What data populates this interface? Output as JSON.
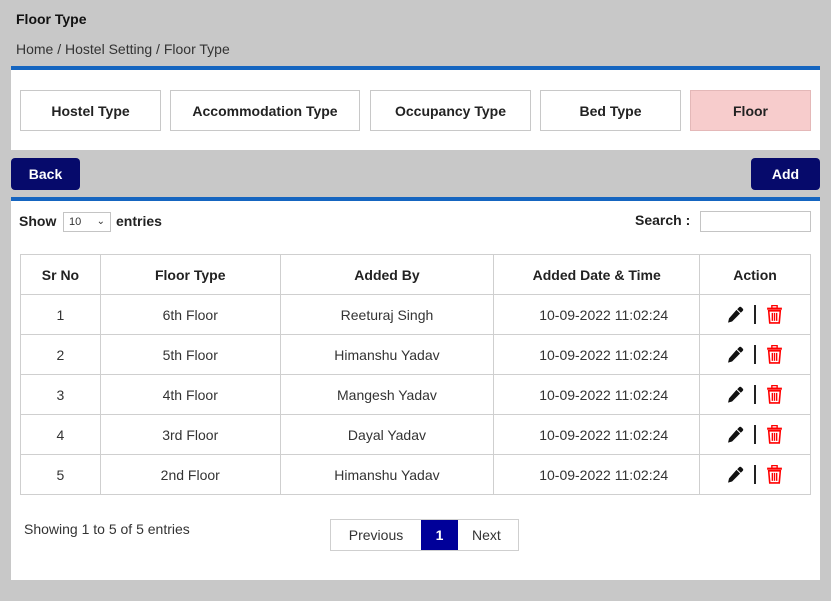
{
  "header": {
    "title": "Floor Type",
    "breadcrumb": "Home / Hostel Setting / Floor Type"
  },
  "tabs": [
    {
      "label": "Hostel Type",
      "active": false
    },
    {
      "label": "Accommodation Type",
      "active": false
    },
    {
      "label": "Occupancy Type",
      "active": false
    },
    {
      "label": "Bed Type",
      "active": false
    },
    {
      "label": "Floor",
      "active": true
    }
  ],
  "toolbar": {
    "back_label": "Back",
    "add_label": "Add"
  },
  "table_controls": {
    "show_label": "Show",
    "entries_value": "10",
    "entries_label": "entries",
    "search_label": "Search :",
    "search_value": "",
    "search_placeholder": ""
  },
  "table": {
    "columns": [
      "Sr No",
      "Floor Type",
      "Added By",
      "Added Date & Time",
      "Action"
    ],
    "rows": [
      {
        "sr": "1",
        "floor": "6th Floor",
        "added_by": "Reeturaj Singh",
        "date": "10-09-2022 11:02:24"
      },
      {
        "sr": "2",
        "floor": "5th Floor",
        "added_by": "Himanshu Yadav",
        "date": "10-09-2022 11:02:24"
      },
      {
        "sr": "3",
        "floor": "4th Floor",
        "added_by": "Mangesh Yadav",
        "date": "10-09-2022 11:02:24"
      },
      {
        "sr": "4",
        "floor": "3rd Floor",
        "added_by": "Dayal Yadav",
        "date": "10-09-2022 11:02:24"
      },
      {
        "sr": "5",
        "floor": "2nd Floor",
        "added_by": "Himanshu Yadav",
        "date": "10-09-2022 11:02:24"
      }
    ],
    "action_icons": {
      "edit": "pencil-icon",
      "delete": "trash-icon"
    }
  },
  "footer": {
    "showing_text": "Showing  1 to 5 of 5 entries",
    "pagination": {
      "previous": "Previous",
      "current": "1",
      "next": "Next"
    }
  },
  "colors": {
    "accent_bar": "#1565c0",
    "button_dark": "#060a6b",
    "active_tab": "#f7cccc",
    "page_current": "#000099",
    "delete_icon": "#ff0000"
  }
}
